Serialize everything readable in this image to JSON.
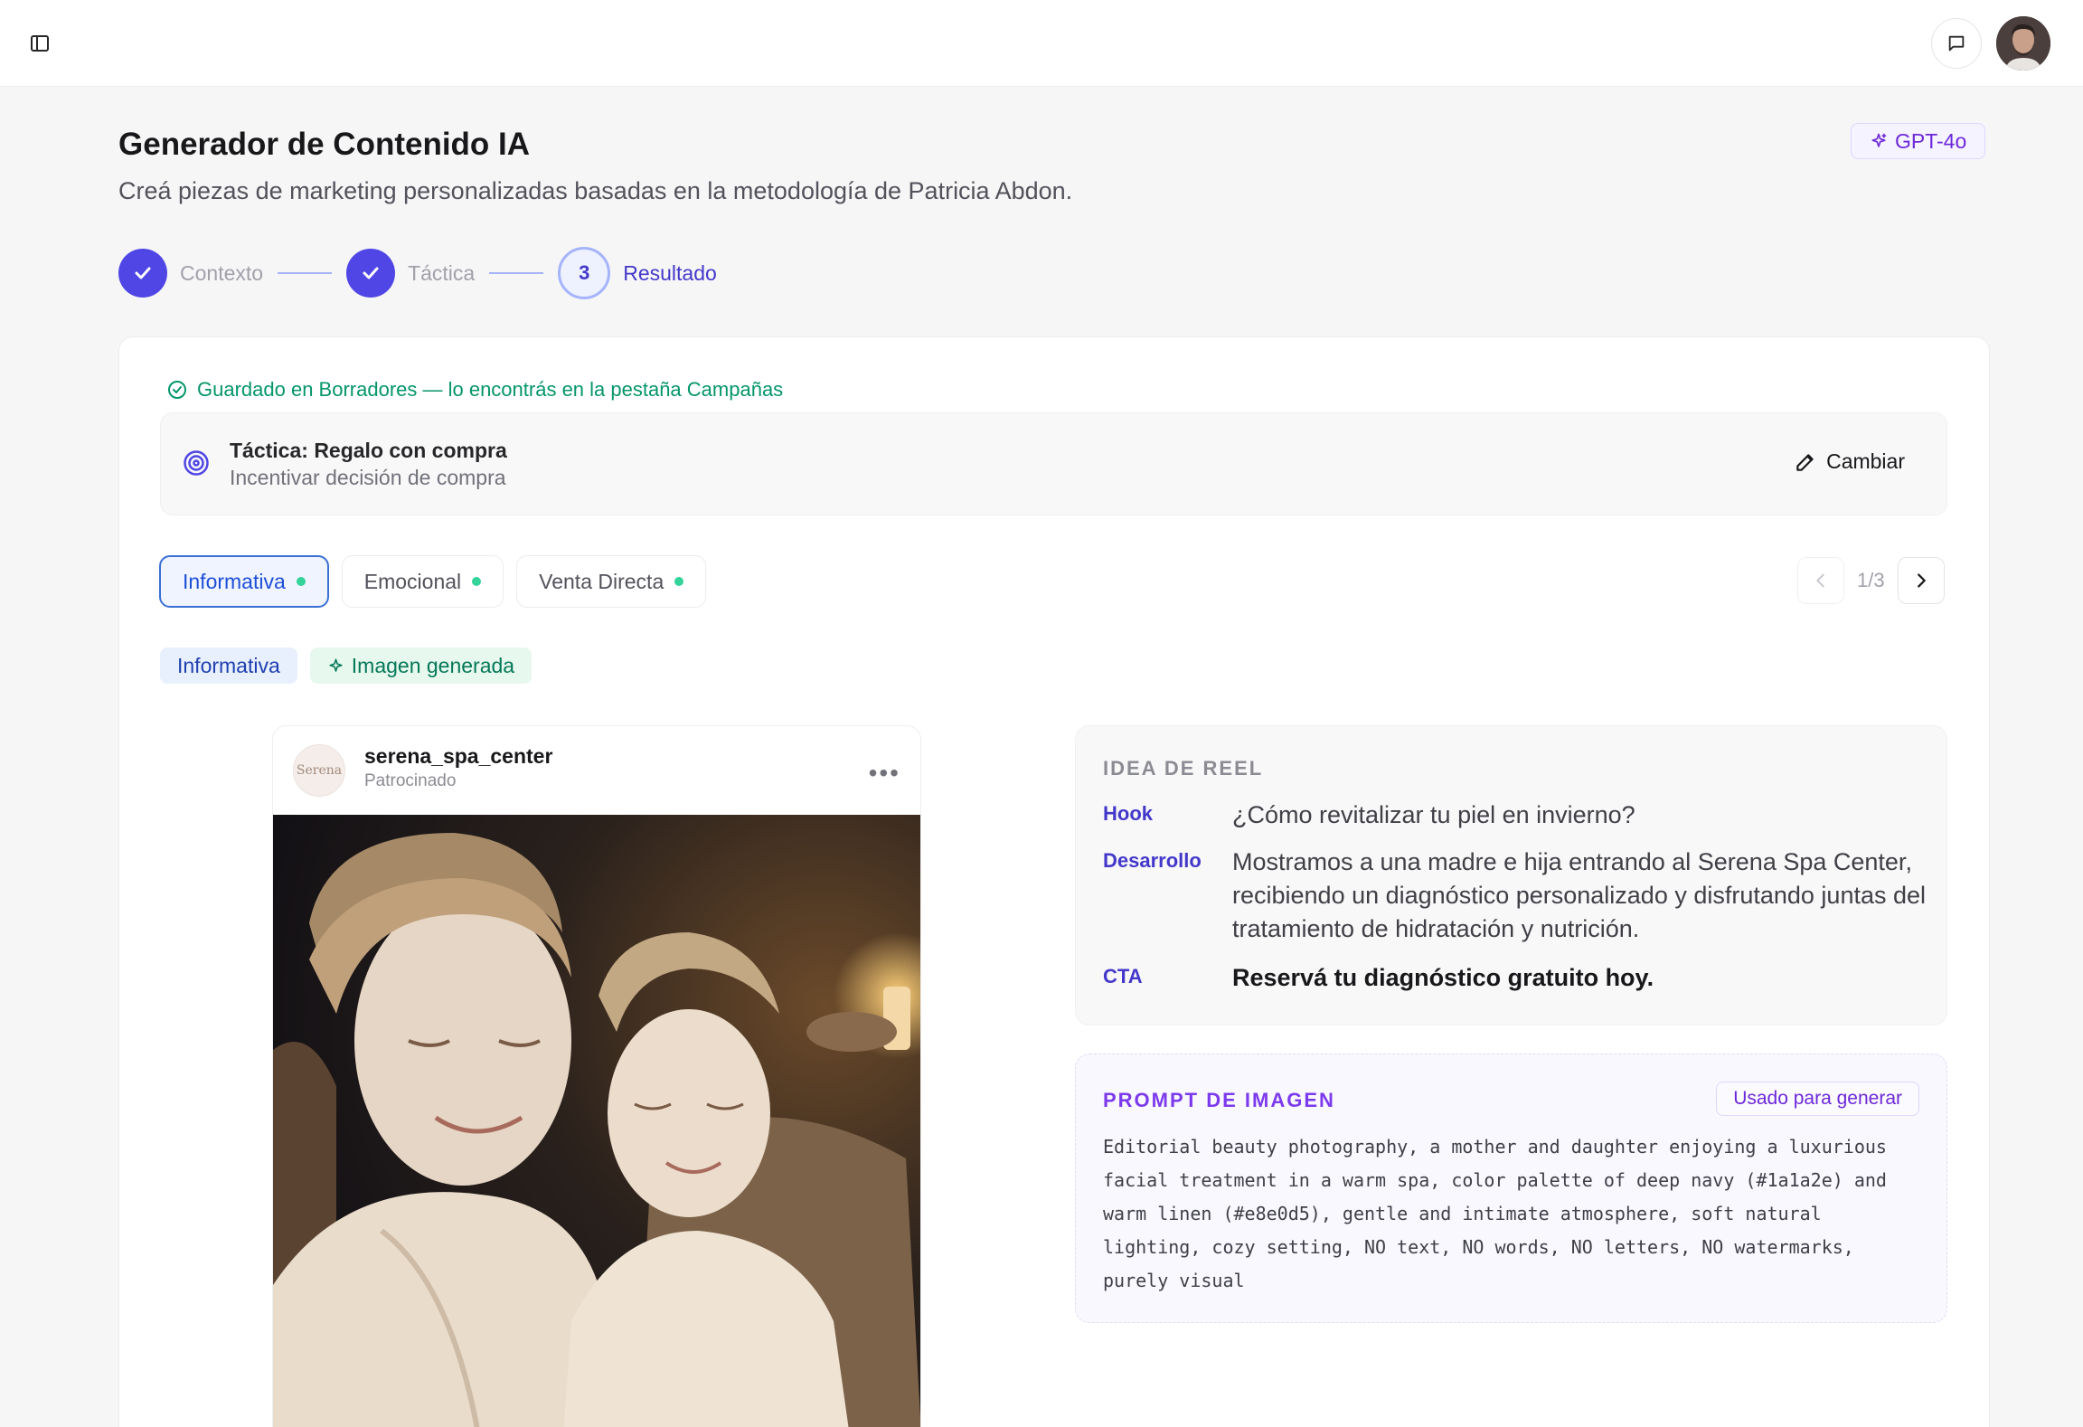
{
  "header": {
    "title": "Generador de Contenido IA",
    "subtitle": "Creá piezas de marketing personalizadas basadas en la metodología de Patricia Abdon.",
    "model_badge": "GPT-4o"
  },
  "stepper": {
    "steps": [
      {
        "label": "Contexto",
        "status": "done"
      },
      {
        "label": "Táctica",
        "status": "done"
      },
      {
        "label": "Resultado",
        "number": "3",
        "status": "current"
      }
    ]
  },
  "saved_notice": "Guardado en Borradores — lo encontrás en la pestaña Campañas",
  "tactic": {
    "title": "Táctica: Regalo con compra",
    "subtitle": "Incentivar decisión de compra",
    "change_label": "Cambiar"
  },
  "tabs": [
    {
      "label": "Informativa",
      "active": true
    },
    {
      "label": "Emocional",
      "active": false
    },
    {
      "label": "Venta Directa",
      "active": false
    }
  ],
  "pager": {
    "count": "1/3"
  },
  "chips": {
    "type": "Informativa",
    "image": "Imagen generada"
  },
  "post": {
    "username": "serena_spa_center",
    "sponsored": "Patrocinado",
    "avatar_text": "Serena"
  },
  "reel": {
    "title": "IDEA DE REEL",
    "rows": [
      {
        "label": "Hook",
        "text": "¿Cómo revitalizar tu piel en invierno?"
      },
      {
        "label": "Desarrollo",
        "text": "Mostramos a una madre e hija entrando al Serena Spa Center, recibiendo un diagnóstico personalizado y disfrutando juntas del tratamiento de hidratación y nutrición."
      },
      {
        "label": "CTA",
        "text": "Reservá tu diagnóstico gratuito hoy."
      }
    ]
  },
  "prompt": {
    "title": "PROMPT DE IMAGEN",
    "badge": "Usado para generar",
    "text": "Editorial beauty photography, a mother and daughter enjoying a luxurious facial treatment in a warm spa, color palette of deep navy (#1a1a2e) and warm linen (#e8e0d5), gentle and intimate atmosphere, soft natural lighting, cozy setting, NO text, NO words, NO letters, NO watermarks, purely visual"
  },
  "colors": {
    "accent": "#4f46e5",
    "success": "#059669",
    "purple": "#7c3aed"
  }
}
